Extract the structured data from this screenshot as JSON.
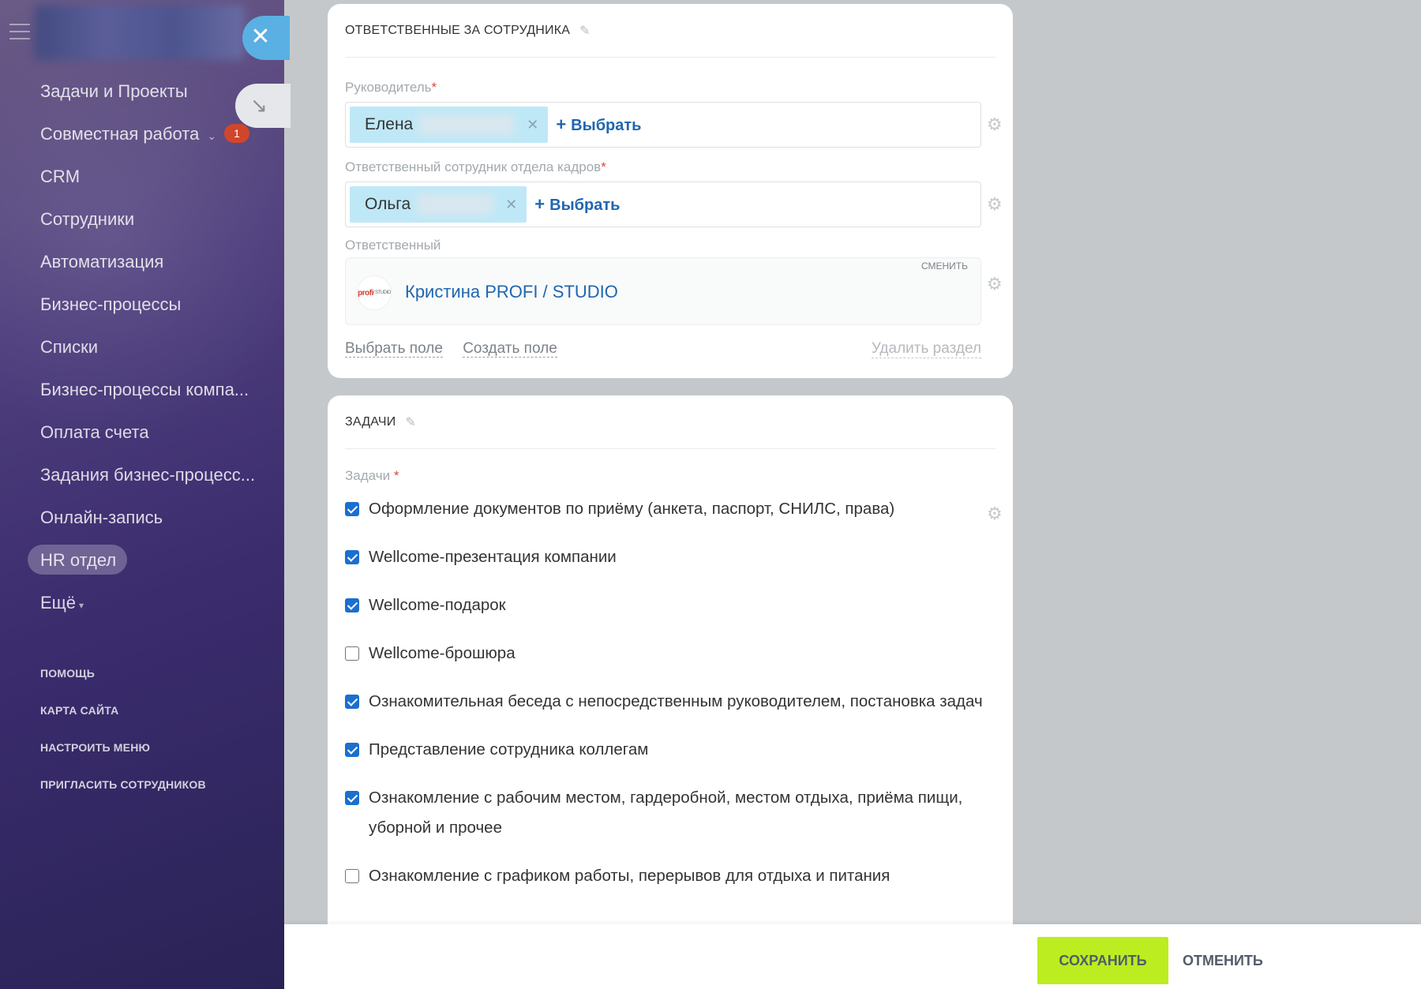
{
  "sidebar": {
    "items": [
      {
        "label": "Задачи и Проекты"
      },
      {
        "label": "Совместная работа",
        "badge": "1"
      },
      {
        "label": "CRM"
      },
      {
        "label": "Сотрудники"
      },
      {
        "label": "Автоматизация"
      },
      {
        "label": "Бизнес-процессы"
      },
      {
        "label": "Списки"
      },
      {
        "label": "Бизнес-процессы компа..."
      },
      {
        "label": "Оплата счета"
      },
      {
        "label": "Задания бизнес-процесс..."
      },
      {
        "label": "Онлайн-запись"
      },
      {
        "label": "HR отдел"
      },
      {
        "label": "Ещё"
      }
    ],
    "footer": [
      "Помощь",
      "Карта сайта",
      "Настроить меню",
      "Пригласить сотрудников"
    ]
  },
  "card_responsible": {
    "title": "ОТВЕТСТВЕННЫЕ ЗА СОТРУДНИКА",
    "manager_label": "Руководитель",
    "manager_value": "Елена",
    "hr_label": "Ответственный сотрудник отдела кадров",
    "hr_value": "Ольга",
    "pick_label": "Выбрать",
    "responsible_label": "Ответственный",
    "responsible_change": "сменить",
    "responsible_avatar": "profi",
    "responsible_avatar_sub": "/ STUDIO",
    "responsible_name": "Кристина PROFI / STUDIO",
    "link_select_field": "Выбрать поле",
    "link_create_field": "Создать поле",
    "link_delete_section": "Удалить раздел"
  },
  "card_tasks": {
    "title": "ЗАДАЧИ",
    "label": "Задачи",
    "items": [
      {
        "text": "Оформление документов по приёму (анкета, паспорт, СНИЛС, права)",
        "checked": true
      },
      {
        "text": "Wellcome-презентация компании",
        "checked": true
      },
      {
        "text": "Wellcome-подарок",
        "checked": true
      },
      {
        "text": "Wellcome-брошюра",
        "checked": false
      },
      {
        "text": "Ознакомительная беседа с непосредственным руководителем, постановка задач",
        "checked": true
      },
      {
        "text": "Представление сотрудника коллегам",
        "checked": true
      },
      {
        "text": "Ознакомление с рабочим местом, гардеробной, местом отдыха, приёма пищи, уборной и прочее",
        "checked": true
      },
      {
        "text": "Ознакомление с графиком работы, перерывов для отдыха и питания",
        "checked": false
      }
    ]
  },
  "actions": {
    "save": "Сохранить",
    "cancel": "Отменить"
  },
  "colors": {
    "accent_blue": "#2066b0",
    "save_green": "#bbed21",
    "badge_red": "#d0462a",
    "chip_blue": "#bfe8f7"
  }
}
